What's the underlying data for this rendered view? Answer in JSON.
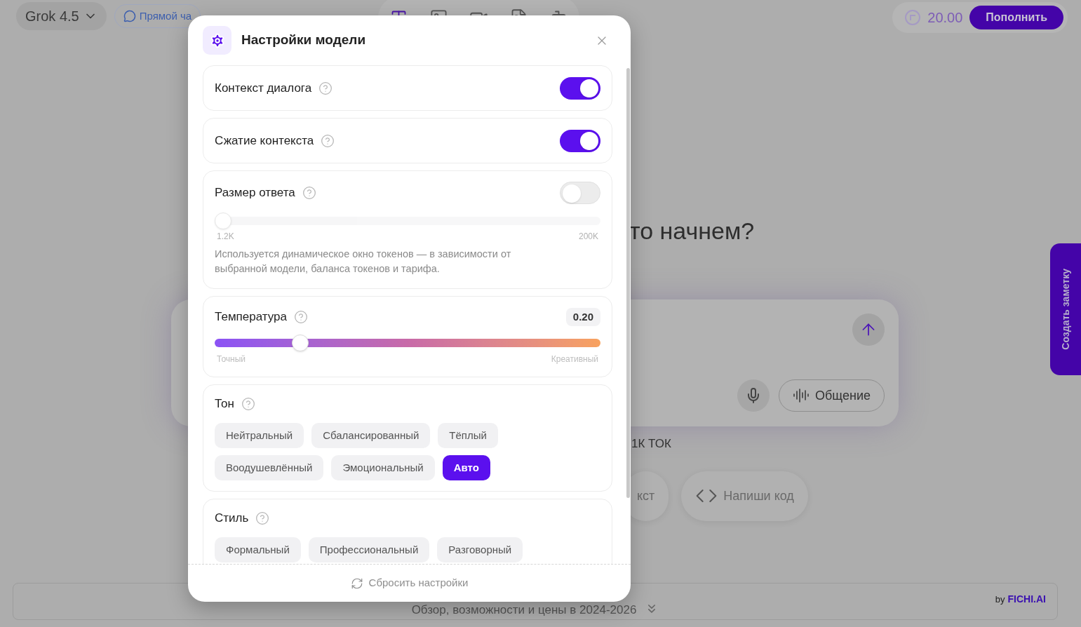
{
  "background": {
    "model_selector": "Grok 4.5",
    "direct_chat": "Прямой ча",
    "modes": [
      {
        "kind": "text",
        "selected": true
      },
      {
        "kind": "image",
        "selected": false
      },
      {
        "kind": "video",
        "selected": false
      },
      {
        "kind": "document",
        "selected": false
      },
      {
        "kind": "agent",
        "selected": false
      }
    ],
    "balance": "20.00",
    "topup_button": "Пополнить",
    "heading": "то начнем?",
    "voice_button": "Общение",
    "token_note": "1К ТОК",
    "suggestions": [
      {
        "kind": "text",
        "label": "кст"
      },
      {
        "kind": "code",
        "label": "Напиши код"
      }
    ],
    "footer_link": "Обзор, возможности и цены в 2024-2026",
    "brand_by": "by",
    "brand": "FICHI.AI",
    "note_tab": "Создать заметку"
  },
  "modal": {
    "title": "Настройки модели",
    "settings": [
      {
        "kind": "toggle",
        "label": "Контекст диалога",
        "on": true
      },
      {
        "kind": "toggle",
        "label": "Сжатие контекста",
        "on": true
      },
      {
        "kind": "toggle_slider",
        "label": "Размер ответа",
        "on": false,
        "level": 0,
        "min_label": "1.2K",
        "max_label": "200K",
        "description": "Используется динамическое окно токенов — в зависимости от выбранной модели, баланса токенов и тарифа."
      },
      {
        "kind": "slider",
        "label": "Температура",
        "value": "0.20",
        "level": 0.21,
        "min_label": "Точный",
        "max_label": "Креативный"
      },
      {
        "kind": "chips",
        "label": "Тон",
        "options": [
          {
            "label": "Нейтральный",
            "selected": false
          },
          {
            "label": "Сбалансированный",
            "selected": false
          },
          {
            "label": "Тёплый",
            "selected": false
          },
          {
            "label": "Воодушевлённый",
            "selected": false
          },
          {
            "label": "Эмоциональный",
            "selected": false
          },
          {
            "label": "Авто",
            "selected": true
          }
        ]
      },
      {
        "kind": "chips",
        "label": "Стиль",
        "options": [
          {
            "label": "Формальный",
            "selected": false
          },
          {
            "label": "Профессиональный",
            "selected": false
          },
          {
            "label": "Разговорный",
            "selected": false
          }
        ]
      }
    ],
    "reset_button": "Сбросить настройки"
  }
}
